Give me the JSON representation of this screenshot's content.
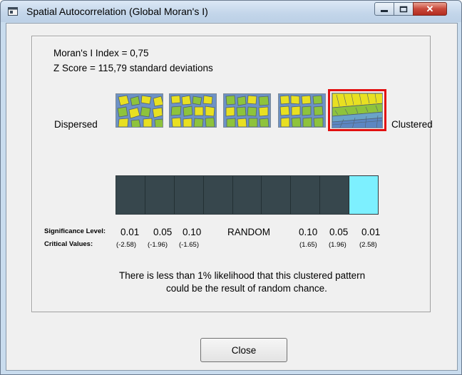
{
  "window": {
    "title": "Spatial Autocorrelation (Global Moran's I)",
    "close_glyph": "✕"
  },
  "results": {
    "morans_index": "Moran's I Index = 0,75",
    "z_score": "Z Score = 115,79 standard deviations"
  },
  "pattern_scale": {
    "left_label": "Dispersed",
    "right_label": "Clustered",
    "selected_index": 4,
    "thumbnails": [
      "pattern-1",
      "pattern-2",
      "pattern-3",
      "pattern-4",
      "pattern-5"
    ]
  },
  "significance": {
    "significance_label": "Significance Level:",
    "critical_label": "Critical Values:",
    "levels": [
      "0.01",
      "0.05",
      "0.10",
      "RANDOM",
      "0.10",
      "0.05",
      "0.01"
    ],
    "critical_values": [
      "(-2.58)",
      "(-1.96)",
      "(-1.65)",
      "",
      "(1.65)",
      "(1.96)",
      "(2.58)"
    ],
    "bar_segments": 9,
    "active_segment": 8,
    "colors": {
      "bar": "#37474d",
      "active": "#7df0ff",
      "highlight": "#e20f0f"
    }
  },
  "message": {
    "line1": "There is less than 1% likelihood that this clustered pattern",
    "line2": "could be the result of random chance."
  },
  "buttons": {
    "close": "Close"
  }
}
